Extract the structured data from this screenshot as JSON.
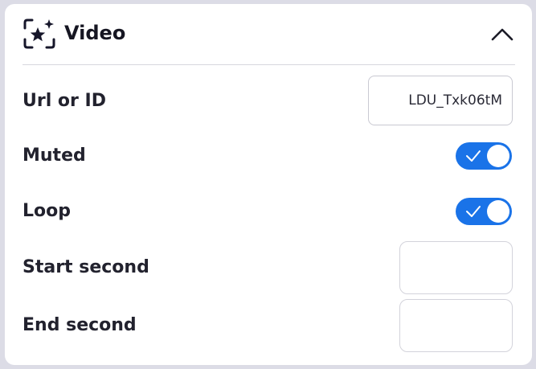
{
  "panel": {
    "title": "Video",
    "header_icon": "video-sparkle-icon",
    "collapse_icon": "chevron-up-icon"
  },
  "fields": {
    "url": {
      "label": "Url or ID",
      "value": "LDU_Txk06tM"
    },
    "muted": {
      "label": "Muted",
      "checked": true
    },
    "loop": {
      "label": "Loop",
      "checked": true
    },
    "start": {
      "label": "Start second",
      "value": ""
    },
    "end": {
      "label": "End second",
      "value": ""
    }
  },
  "colors": {
    "toggle_on": "#1a73e8",
    "background": "#dcdce6",
    "panel": "#ffffff"
  }
}
